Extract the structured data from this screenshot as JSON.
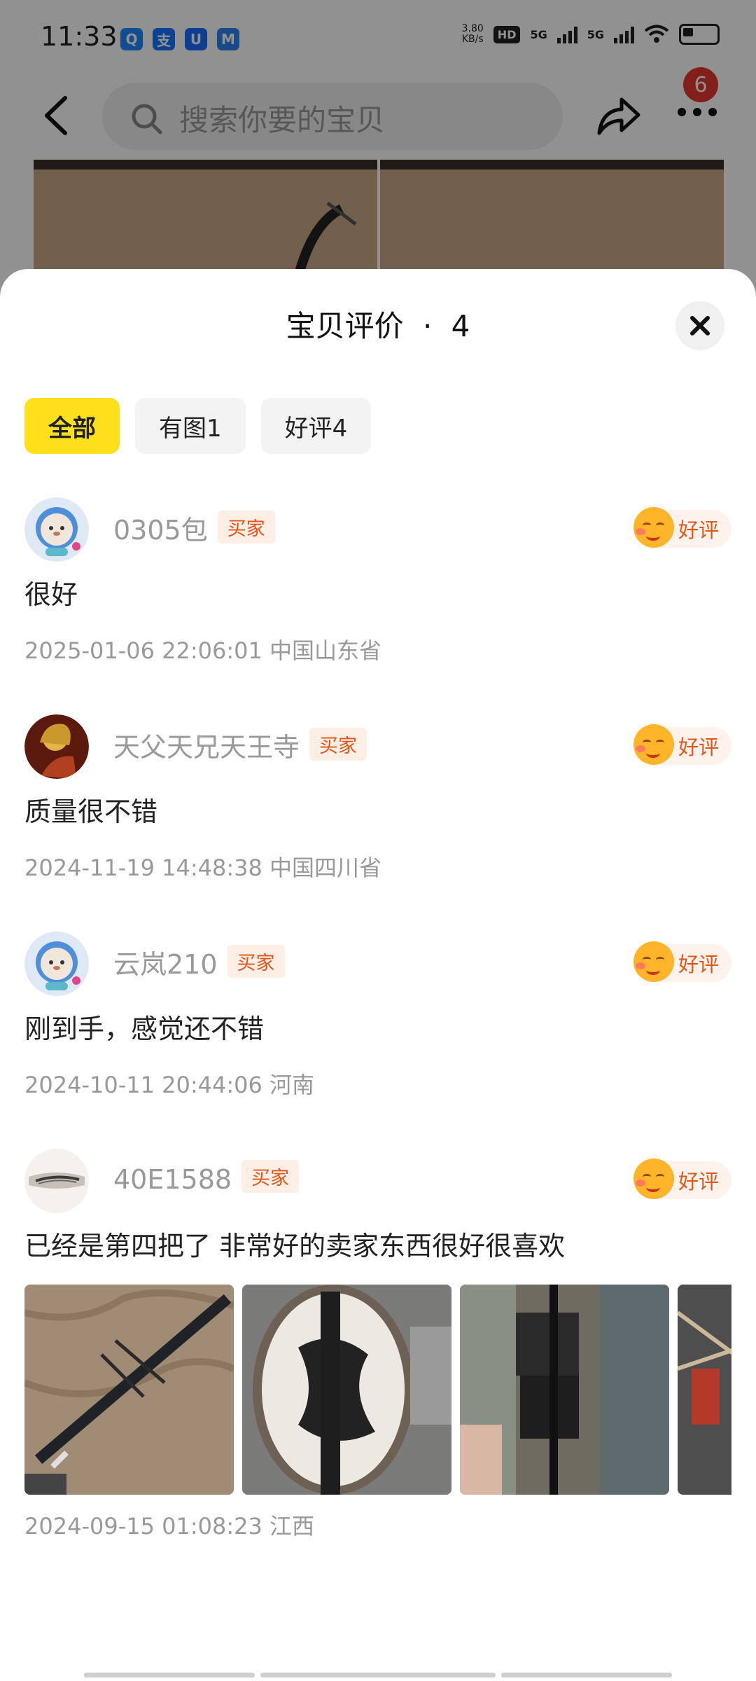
{
  "status_bar": {
    "time": "11:33",
    "net_speed": "3.80",
    "net_unit": "KB/s",
    "hd": "HD",
    "sim1": "5G",
    "sim2": "5G",
    "apps": [
      {
        "icon": "qq-icon",
        "glyph": "Q",
        "color": "#1e88ff"
      },
      {
        "icon": "alipay-icon",
        "glyph": "支",
        "color": "#1677ff"
      },
      {
        "icon": "shield-app-icon",
        "glyph": "U",
        "color": "#1a6cff"
      },
      {
        "icon": "m-app-icon",
        "glyph": "M",
        "color": "#2f80ed"
      }
    ]
  },
  "header": {
    "search_placeholder": "搜索你要的宝贝",
    "badge_count": "6"
  },
  "sheet": {
    "title": "宝贝评价",
    "separator": "·",
    "count": "4",
    "filters": [
      {
        "label": "全部",
        "active": true
      },
      {
        "label": "有图1",
        "active": false
      },
      {
        "label": "好评4",
        "active": false
      }
    ]
  },
  "reviews": [
    {
      "user": "0305包",
      "tag": "买家",
      "rating": "好评",
      "text": "很好",
      "time": "2025-01-06 22:06:01",
      "location": "中国山东省"
    },
    {
      "user": "天父天兄天王寺",
      "tag": "买家",
      "rating": "好评",
      "text": "质量很不错",
      "time": "2024-11-19 14:48:38",
      "location": "中国四川省"
    },
    {
      "user": "云岚210",
      "tag": "买家",
      "rating": "好评",
      "text": "刚到手，感觉还不错",
      "time": "2024-10-11 20:44:06",
      "location": "河南"
    },
    {
      "user": "40E1588",
      "tag": "买家",
      "rating": "好评",
      "text": "已经是第四把了 非常好的卖家东西很好很喜欢",
      "time": "2024-09-15 01:08:23",
      "location": "江西"
    }
  ]
}
